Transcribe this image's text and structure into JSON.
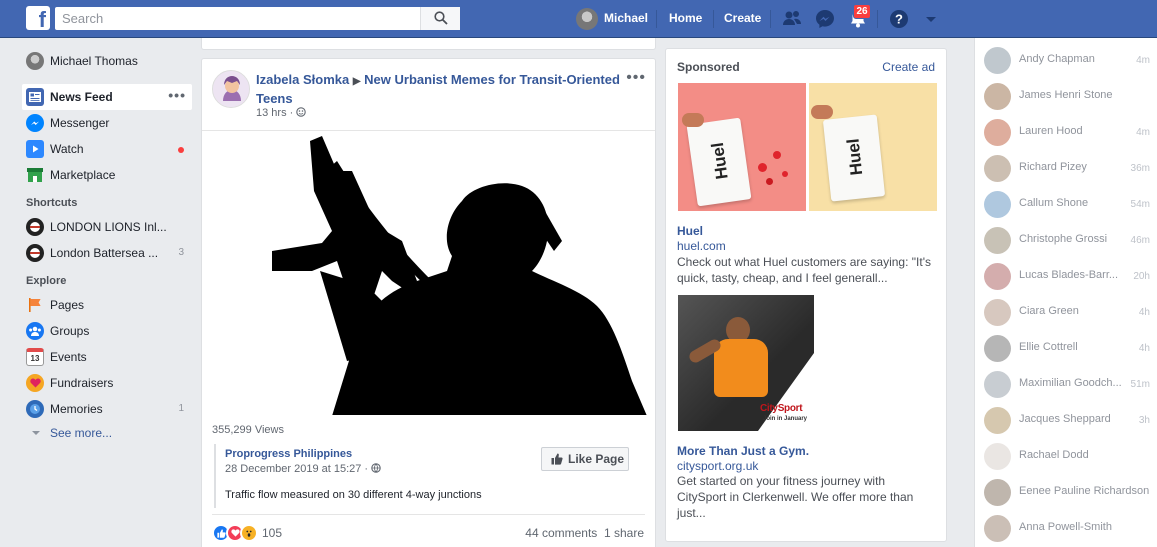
{
  "topbar": {
    "logo": "f",
    "search_placeholder": "Search",
    "user_name": "Michael",
    "home": "Home",
    "create": "Create",
    "notifications_count": "26",
    "icons": [
      "friends-icon",
      "messenger-icon",
      "bell-icon",
      "help-icon",
      "caret-down-icon"
    ]
  },
  "left": {
    "profile_name": "Michael Thomas",
    "main_items": [
      {
        "label": "News Feed",
        "icon": "news-feed-icon"
      },
      {
        "label": "Messenger",
        "icon": "messenger-icon"
      },
      {
        "label": "Watch",
        "icon": "watch-icon"
      },
      {
        "label": "Marketplace",
        "icon": "marketplace-icon"
      }
    ],
    "shortcuts_heading": "Shortcuts",
    "shortcuts": [
      {
        "label": "LONDON LIONS Inl...",
        "count": ""
      },
      {
        "label": "London Battersea ...",
        "count": "3"
      }
    ],
    "explore_heading": "Explore",
    "explore": [
      {
        "label": "Pages",
        "count": ""
      },
      {
        "label": "Groups",
        "count": ""
      },
      {
        "label": "Events",
        "count": ""
      },
      {
        "label": "Fundraisers",
        "count": ""
      },
      {
        "label": "Memories",
        "count": "1"
      }
    ],
    "events_icon_number": "13",
    "see_more": "See more..."
  },
  "post": {
    "author": "Izabela Słomka",
    "arrow": "▶",
    "group": "New Urbanist Memes for Transit-Oriented Teens",
    "time": "13 hrs ·",
    "views": "355,299 Views",
    "shared_page": "Proprogress Philippines",
    "shared_date": "28 December 2019 at 15:27 ·",
    "shared_text": "Traffic flow measured on 30 different 4-way junctions",
    "like_page": "Like Page",
    "reaction_count": "105",
    "comments": "44 comments",
    "shares": "1 share"
  },
  "sponsored": {
    "title": "Sponsored",
    "create_ad": "Create ad",
    "ads": [
      {
        "name": "Huel",
        "url": "huel.com",
        "desc": "Check out what Huel customers are saying: \"It's quick, tasty, cheap, and I feel generall...",
        "brand_text": "Huel"
      },
      {
        "name": "More Than Just a Gym.",
        "url": "citysport.org.uk",
        "desc": "Get started on your fitness journey with CitySport in Clerkenwell. We offer more than just...",
        "brand_text": "CitySport",
        "brand_tag": "Join in January"
      }
    ]
  },
  "chat": [
    {
      "name": "Andy Chapman",
      "time": "4m"
    },
    {
      "name": "James Henri Stone",
      "time": ""
    },
    {
      "name": "Lauren Hood",
      "time": "4m"
    },
    {
      "name": "Richard Pizey",
      "time": "36m"
    },
    {
      "name": "Callum Shone",
      "time": "54m"
    },
    {
      "name": "Christophe Grossi",
      "time": "46m"
    },
    {
      "name": "Lucas Blades-Barr...",
      "time": "20h"
    },
    {
      "name": "Ciara Green",
      "time": "4h"
    },
    {
      "name": "Ellie Cottrell",
      "time": "4h"
    },
    {
      "name": "Maximilian Goodch...",
      "time": "51m"
    },
    {
      "name": "Jacques Sheppard",
      "time": "3h"
    },
    {
      "name": "Rachael Dodd",
      "time": ""
    },
    {
      "name": "Eenee Pauline Richardson",
      "time": ""
    },
    {
      "name": "Anna Powell-Smith",
      "time": ""
    }
  ]
}
